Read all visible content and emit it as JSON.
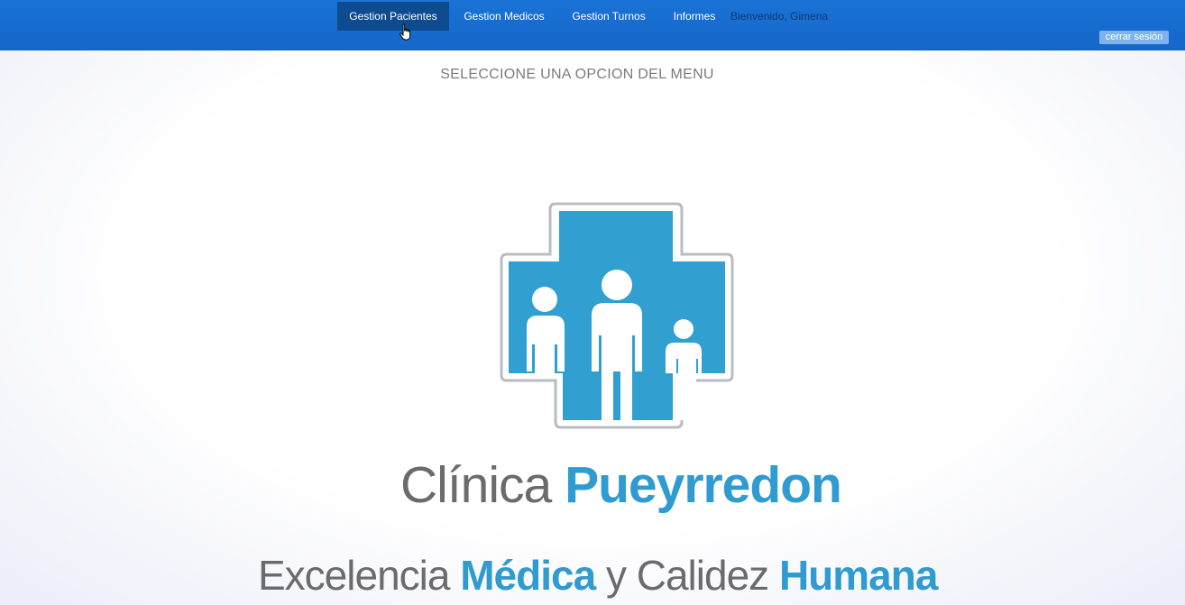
{
  "navbar": {
    "items": [
      {
        "label": "Gestion Pacientes",
        "active": true
      },
      {
        "label": "Gestion Medicos",
        "active": false
      },
      {
        "label": "Gestion Turnos",
        "active": false
      },
      {
        "label": "Informes",
        "active": false
      }
    ],
    "welcome": "Bienvenido, Gimena",
    "logout_label": "cerrar sesión"
  },
  "main": {
    "prompt": "SELECCIONE UNA OPCION DEL MENU"
  },
  "brand": {
    "name_light": "Clínica",
    "name_bold": "Pueyrredon",
    "slogan_part1": "Excelencia",
    "slogan_part2": "Médica",
    "slogan_part3": "y Calidez",
    "slogan_part4": "Humana"
  },
  "colors": {
    "navbar": "#1566c8",
    "nav_active": "#0d4c91",
    "brand_blue": "#2f9bd0",
    "brand_gray": "#6b6b6b"
  },
  "icons": {
    "logo": "medical-cross-family-icon",
    "cursor": "hand-pointer-icon"
  }
}
